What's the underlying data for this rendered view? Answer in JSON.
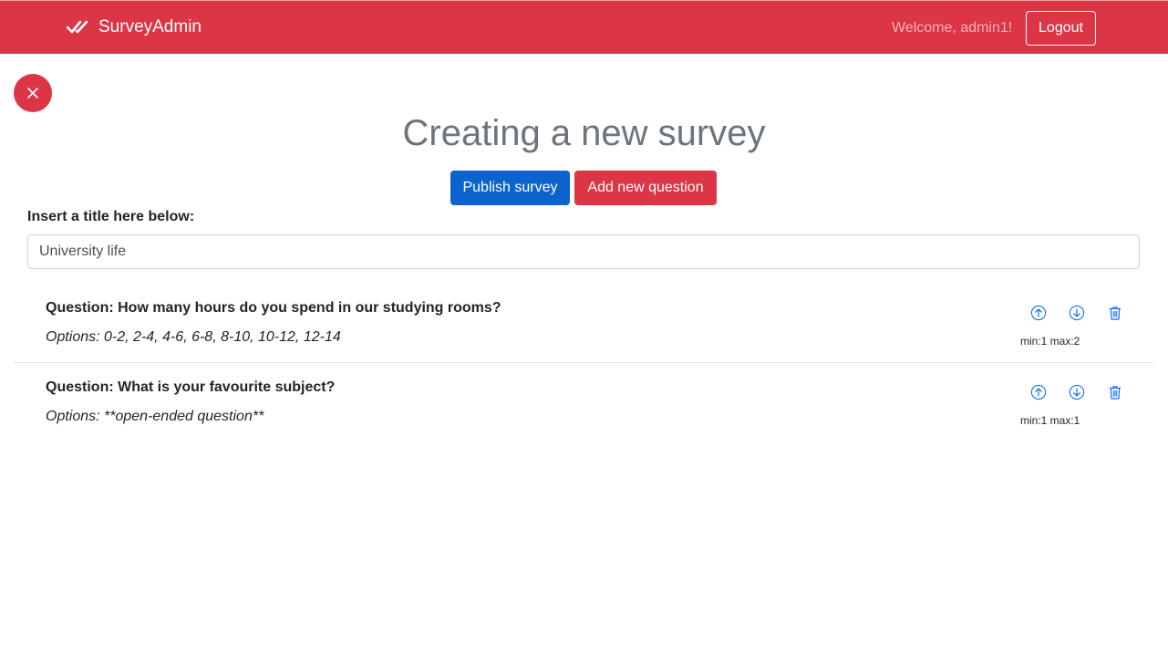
{
  "navbar": {
    "brand": "SurveyAdmin",
    "welcome": "Welcome, admin1!",
    "logout_label": "Logout",
    "color": "#dc3545"
  },
  "page": {
    "title": "Creating a new survey",
    "publish_label": "Publish survey",
    "add_question_label": "Add new question",
    "title_label": "Insert a title here below:",
    "title_value": "University life"
  },
  "questions": [
    {
      "text": "Question: How many hours do you spend in our studying rooms?",
      "options": "Options: 0-2, 2-4, 4-6, 6-8, 8-10, 10-12, 12-14",
      "minmax": "min:1 max:2"
    },
    {
      "text": "Question: What is your favourite subject?",
      "options": "Options: **open-ended question**",
      "minmax": "min:1 max:1"
    }
  ],
  "icons": {
    "brand": "double-check-icon",
    "close": "close-icon",
    "move_up": "arrow-up-circle-icon",
    "move_down": "arrow-down-circle-icon",
    "delete": "trash-icon"
  },
  "colors": {
    "accent": "#dc3545",
    "primary": "#0b63ce",
    "icon": "#0d6efd"
  }
}
